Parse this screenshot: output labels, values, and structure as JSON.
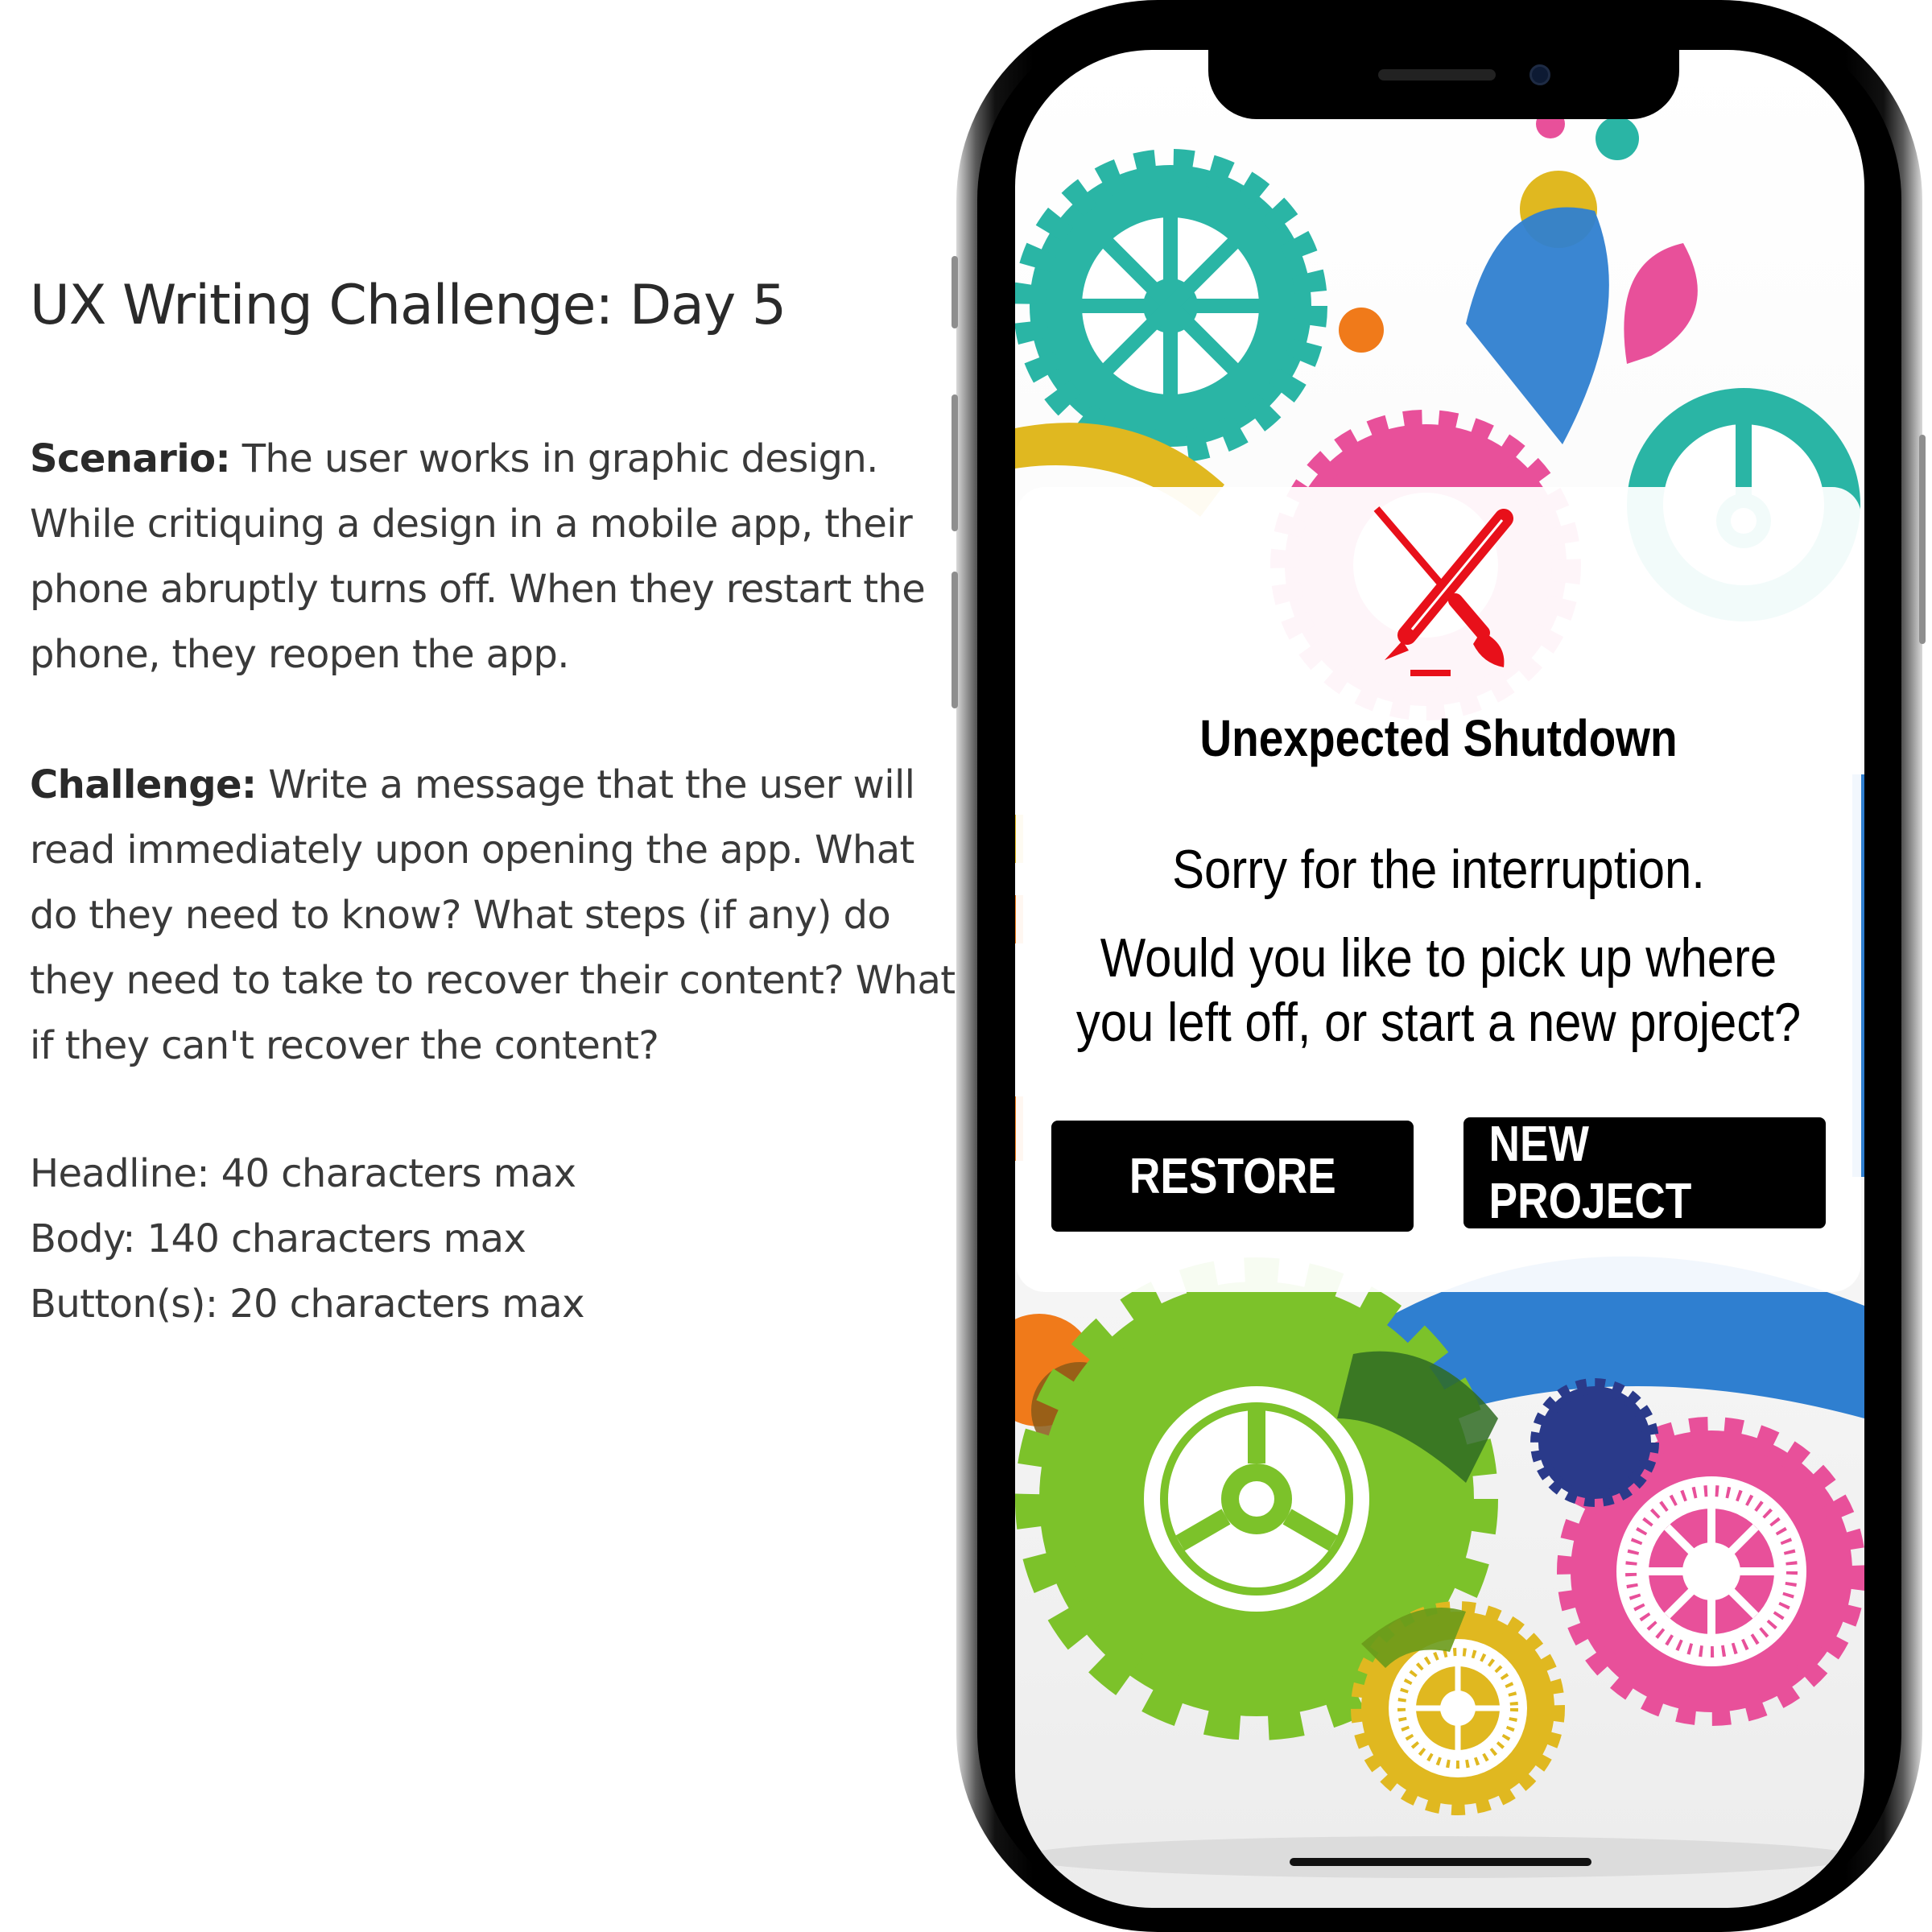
{
  "brief": {
    "title": "UX Writing Challenge: Day 5",
    "scenario": {
      "label": "Scenario:",
      "text": " The user works in graphic design. While critiquing a design in a mobile app, their phone abruptly turns off. When they restart the phone, they reopen the app."
    },
    "challenge": {
      "label": "Challenge:",
      "text": " Write a message that the user will read immediately upon opening the app. What do they need to know? What steps (if any) do they need to take to recover their content? What if they can't recover the content?"
    },
    "limits": [
      "Headline: 40 characters max",
      "Body: 140 characters max",
      "Button(s): 20 characters max"
    ]
  },
  "dialog": {
    "icon": "crossed-pencil-brush-icon",
    "icon_color": "#e8101a",
    "title": "Unexpected Shutdown",
    "body_line1": "Sorry for the interruption.",
    "body_line2": "Would you like to pick up where you left off, or start a new project?",
    "buttons": {
      "restore": "RESTORE",
      "new_project": "NEW PROJECT"
    }
  },
  "background": {
    "illustration": "colorful-gears-illustration",
    "colors": [
      "#2ab5a5",
      "#e8509a",
      "#7cc22a",
      "#e0b820",
      "#2f7fd0",
      "#f07a1a"
    ]
  }
}
